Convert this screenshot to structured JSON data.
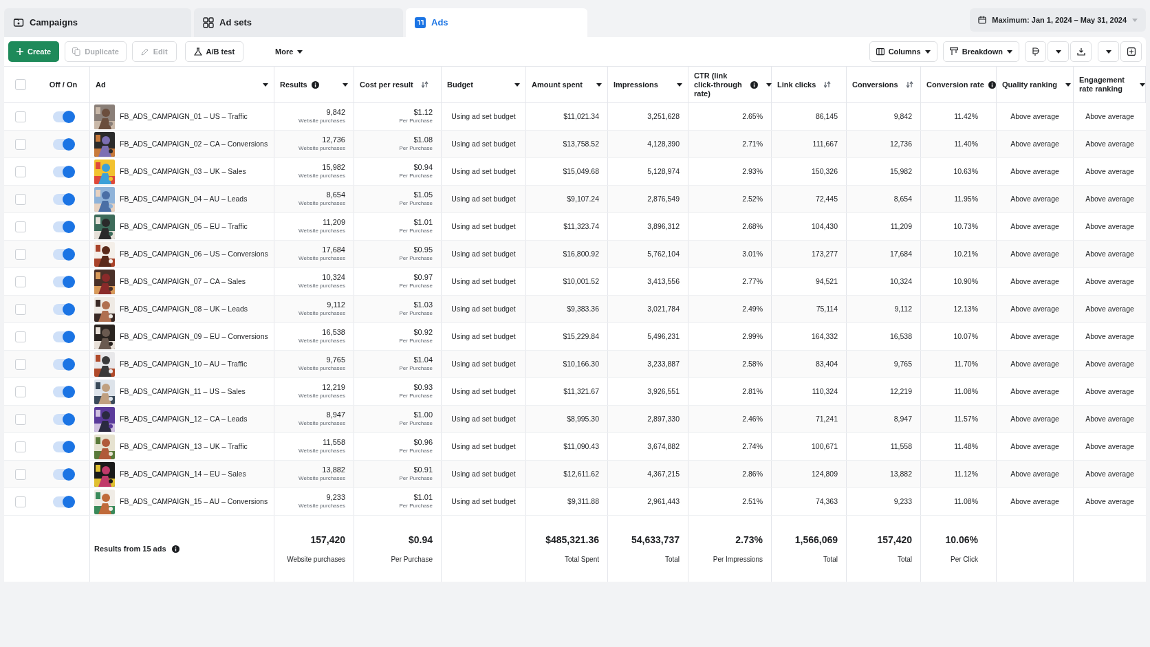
{
  "tabs": [
    {
      "label": "Campaigns",
      "selected": false
    },
    {
      "label": "Ad sets",
      "selected": false
    },
    {
      "label": "Ads",
      "selected": true
    }
  ],
  "select_all_checked": false,
  "date_range": "Maximum: Jan 1, 2024 – May 31, 2024",
  "toolbar": [
    {
      "label": "Create",
      "kind": "primary",
      "disabled": false
    },
    {
      "label": "Duplicate",
      "kind": "copy",
      "disabled": true
    },
    {
      "label": "Edit",
      "kind": "edit",
      "disabled": true
    },
    {
      "label": "A/B test",
      "kind": "test",
      "disabled": false
    },
    {
      "label": "More",
      "kind": "menu",
      "disabled": false
    }
  ],
  "toolbar_right": [
    {
      "label": "Columns",
      "kind": "columns"
    },
    {
      "label": "Breakdown",
      "kind": "breakdown"
    }
  ],
  "columns": [
    {
      "label": "Off / On",
      "kind": "plain",
      "info": false
    },
    {
      "label": "Ad",
      "kind": "caret",
      "info": false
    },
    {
      "label": "Results",
      "kind": "caret",
      "info": true
    },
    {
      "label": "Cost per result",
      "kind": "sort",
      "info": false
    },
    {
      "label": "Budget",
      "kind": "caret",
      "info": false
    },
    {
      "label": "Amount spent",
      "kind": "caret",
      "info": false
    },
    {
      "label": "Impressions",
      "kind": "caret",
      "info": false
    },
    {
      "label": "CTR (link click-through rate)",
      "kind": "caret",
      "info": true
    },
    {
      "label": "Link clicks",
      "kind": "sort",
      "info": false
    },
    {
      "label": "Conversions",
      "kind": "sort",
      "info": false
    },
    {
      "label": "Conversion rate",
      "kind": "plain",
      "info": true
    },
    {
      "label": "Quality ranking",
      "kind": "caret",
      "info": false
    },
    {
      "label": "Engagement rate ranking",
      "kind": "caret",
      "info": false
    }
  ],
  "rows": [
    {
      "checked": false,
      "on": true,
      "ad": "FB_ADS_CAMPAIGN_01 – US – Traffic",
      "results": "9,842",
      "results_unit": "Website purchases",
      "cost": "$1.12",
      "cost_unit": "Per Purchase",
      "budget": "Using ad set budget",
      "spent": "$11,021.34",
      "impressions": "3,251,628",
      "ctr": "2.65%",
      "link_clicks": "86,145",
      "conversions": "9,842",
      "conversion_rate": "11.42%",
      "quality": "Above average",
      "engagement": "Above average"
    },
    {
      "checked": false,
      "on": true,
      "ad": "FB_ADS_CAMPAIGN_02 – CA – Conversions",
      "results": "12,736",
      "results_unit": "Website purchases",
      "cost": "$1.08",
      "cost_unit": "Per Purchase",
      "budget": "Using ad set budget",
      "spent": "$13,758.52",
      "impressions": "4,128,390",
      "ctr": "2.71%",
      "link_clicks": "111,667",
      "conversions": "12,736",
      "conversion_rate": "11.40%",
      "quality": "Above average",
      "engagement": "Above average"
    },
    {
      "checked": false,
      "on": true,
      "ad": "FB_ADS_CAMPAIGN_03 – UK – Sales",
      "results": "15,982",
      "results_unit": "Website purchases",
      "cost": "$0.94",
      "cost_unit": "Per Purchase",
      "budget": "Using ad set budget",
      "spent": "$15,049.68",
      "impressions": "5,128,974",
      "ctr": "2.93%",
      "link_clicks": "150,326",
      "conversions": "15,982",
      "conversion_rate": "10.63%",
      "quality": "Above average",
      "engagement": "Above average"
    },
    {
      "checked": false,
      "on": true,
      "ad": "FB_ADS_CAMPAIGN_04 – AU – Leads",
      "results": "8,654",
      "results_unit": "Website purchases",
      "cost": "$1.05",
      "cost_unit": "Per Purchase",
      "budget": "Using ad set budget",
      "spent": "$9,107.24",
      "impressions": "2,876,549",
      "ctr": "2.52%",
      "link_clicks": "72,445",
      "conversions": "8,654",
      "conversion_rate": "11.95%",
      "quality": "Above average",
      "engagement": "Above average"
    },
    {
      "checked": false,
      "on": true,
      "ad": "FB_ADS_CAMPAIGN_05 – EU – Traffic",
      "results": "11,209",
      "results_unit": "Website purchases",
      "cost": "$1.01",
      "cost_unit": "Per Purchase",
      "budget": "Using ad set budget",
      "spent": "$11,323.74",
      "impressions": "3,896,312",
      "ctr": "2.68%",
      "link_clicks": "104,430",
      "conversions": "11,209",
      "conversion_rate": "10.73%",
      "quality": "Above average",
      "engagement": "Above average"
    },
    {
      "checked": false,
      "on": true,
      "ad": "FB_ADS_CAMPAIGN_06 – US – Conversions",
      "results": "17,684",
      "results_unit": "Website purchases",
      "cost": "$0.95",
      "cost_unit": "Per Purchase",
      "budget": "Using ad set budget",
      "spent": "$16,800.92",
      "impressions": "5,762,104",
      "ctr": "3.01%",
      "link_clicks": "173,277",
      "conversions": "17,684",
      "conversion_rate": "10.21%",
      "quality": "Above average",
      "engagement": "Above average"
    },
    {
      "checked": false,
      "on": true,
      "ad": "FB_ADS_CAMPAIGN_07 – CA – Sales",
      "results": "10,324",
      "results_unit": "Website purchases",
      "cost": "$0.97",
      "cost_unit": "Per Purchase",
      "budget": "Using ad set budget",
      "spent": "$10,001.52",
      "impressions": "3,413,556",
      "ctr": "2.77%",
      "link_clicks": "94,521",
      "conversions": "10,324",
      "conversion_rate": "10.90%",
      "quality": "Above average",
      "engagement": "Above average"
    },
    {
      "checked": false,
      "on": true,
      "ad": "FB_ADS_CAMPAIGN_08 – UK – Leads",
      "results": "9,112",
      "results_unit": "Website purchases",
      "cost": "$1.03",
      "cost_unit": "Per Purchase",
      "budget": "Using ad set budget",
      "spent": "$9,383.36",
      "impressions": "3,021,784",
      "ctr": "2.49%",
      "link_clicks": "75,114",
      "conversions": "9,112",
      "conversion_rate": "12.13%",
      "quality": "Above average",
      "engagement": "Above average"
    },
    {
      "checked": false,
      "on": true,
      "ad": "FB_ADS_CAMPAIGN_09 – EU – Conversions",
      "results": "16,538",
      "results_unit": "Website purchases",
      "cost": "$0.92",
      "cost_unit": "Per Purchase",
      "budget": "Using ad set budget",
      "spent": "$15,229.84",
      "impressions": "5,496,231",
      "ctr": "2.99%",
      "link_clicks": "164,332",
      "conversions": "16,538",
      "conversion_rate": "10.07%",
      "quality": "Above average",
      "engagement": "Above average"
    },
    {
      "checked": false,
      "on": true,
      "ad": "FB_ADS_CAMPAIGN_10 – AU – Traffic",
      "results": "9,765",
      "results_unit": "Website purchases",
      "cost": "$1.04",
      "cost_unit": "Per Purchase",
      "budget": "Using ad set budget",
      "spent": "$10,166.30",
      "impressions": "3,233,887",
      "ctr": "2.58%",
      "link_clicks": "83,404",
      "conversions": "9,765",
      "conversion_rate": "11.70%",
      "quality": "Above average",
      "engagement": "Above average"
    },
    {
      "checked": false,
      "on": true,
      "ad": "FB_ADS_CAMPAIGN_11 – US – Sales",
      "results": "12,219",
      "results_unit": "Website purchases",
      "cost": "$0.93",
      "cost_unit": "Per Purchase",
      "budget": "Using ad set budget",
      "spent": "$11,321.67",
      "impressions": "3,926,551",
      "ctr": "2.81%",
      "link_clicks": "110,324",
      "conversions": "12,219",
      "conversion_rate": "11.08%",
      "quality": "Above average",
      "engagement": "Above average"
    },
    {
      "checked": false,
      "on": true,
      "ad": "FB_ADS_CAMPAIGN_12 – CA – Leads",
      "results": "8,947",
      "results_unit": "Website purchases",
      "cost": "$1.00",
      "cost_unit": "Per Purchase",
      "budget": "Using ad set budget",
      "spent": "$8,995.30",
      "impressions": "2,897,330",
      "ctr": "2.46%",
      "link_clicks": "71,241",
      "conversions": "8,947",
      "conversion_rate": "11.57%",
      "quality": "Above average",
      "engagement": "Above average"
    },
    {
      "checked": false,
      "on": true,
      "ad": "FB_ADS_CAMPAIGN_13 – UK – Traffic",
      "results": "11,558",
      "results_unit": "Website purchases",
      "cost": "$0.96",
      "cost_unit": "Per Purchase",
      "budget": "Using ad set budget",
      "spent": "$11,090.43",
      "impressions": "3,674,882",
      "ctr": "2.74%",
      "link_clicks": "100,671",
      "conversions": "11,558",
      "conversion_rate": "11.48%",
      "quality": "Above average",
      "engagement": "Above average"
    },
    {
      "checked": false,
      "on": true,
      "ad": "FB_ADS_CAMPAIGN_14 – EU – Sales",
      "results": "13,882",
      "results_unit": "Website purchases",
      "cost": "$0.91",
      "cost_unit": "Per Purchase",
      "budget": "Using ad set budget",
      "spent": "$12,611.62",
      "impressions": "4,367,215",
      "ctr": "2.86%",
      "link_clicks": "124,809",
      "conversions": "13,882",
      "conversion_rate": "11.12%",
      "quality": "Above average",
      "engagement": "Above average"
    },
    {
      "checked": false,
      "on": true,
      "ad": "FB_ADS_CAMPAIGN_15 – AU – Conversions",
      "results": "9,233",
      "results_unit": "Website purchases",
      "cost": "$1.01",
      "cost_unit": "Per Purchase",
      "budget": "Using ad set budget",
      "spent": "$9,311.88",
      "impressions": "2,961,443",
      "ctr": "2.51%",
      "link_clicks": "74,363",
      "conversions": "9,233",
      "conversion_rate": "11.08%",
      "quality": "Above average",
      "engagement": "Above average"
    }
  ],
  "totals": {
    "label": "Results from 15 ads",
    "results": {
      "value": "157,420",
      "unit": "Website purchases"
    },
    "cost": {
      "value": "$0.94",
      "unit": "Per Purchase"
    },
    "spent": {
      "value": "$485,321.36",
      "unit": "Total Spent"
    },
    "impressions": {
      "value": "54,633,737",
      "unit": "Total"
    },
    "ctr": {
      "value": "2.73%",
      "unit": "Per Impressions"
    },
    "link_clicks": {
      "value": "1,566,069",
      "unit": "Total"
    },
    "conversions": {
      "value": "157,420",
      "unit": "Total"
    },
    "conversion_rate": {
      "value": "10.06%",
      "unit": "Per Click"
    }
  }
}
